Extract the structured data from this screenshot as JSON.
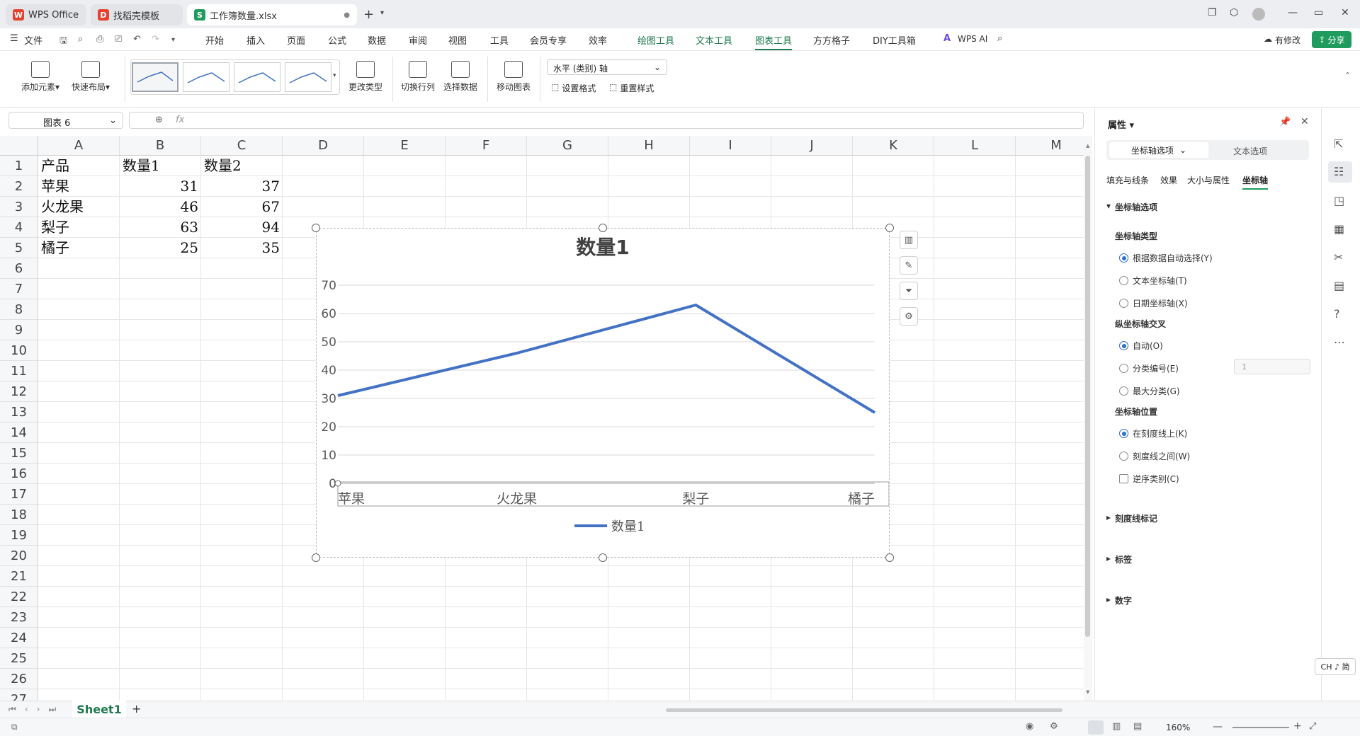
{
  "tabs": [
    {
      "label": "WPS Office"
    },
    {
      "label": "找稻壳模板"
    },
    {
      "label": "工作簿数量.xlsx"
    }
  ],
  "menu": {
    "file": "文件",
    "items": [
      "开始",
      "插入",
      "页面",
      "公式",
      "数据",
      "审阅",
      "视图",
      "工具",
      "会员专享",
      "效率",
      "绘图工具",
      "文本工具",
      "图表工具",
      "方方格子",
      "DIY工具箱"
    ],
    "wps_ai": "WPS AI",
    "modified": "有修改",
    "share": "分享"
  },
  "ribbon": {
    "add_element": "添加元素",
    "quick_layout": "快速布局",
    "change_type": "更改类型",
    "switch_rowcol": "切换行列",
    "select_data": "选择数据",
    "move_chart": "移动图表",
    "axis_select": "水平 (类别) 轴",
    "set_format": "设置格式",
    "reset_style": "重置样式"
  },
  "formula": {
    "namebox": "图表 6",
    "fx": "fx"
  },
  "columns": [
    "A",
    "B",
    "C",
    "D",
    "E",
    "F",
    "G",
    "H",
    "I",
    "J",
    "K",
    "L",
    "M"
  ],
  "rows": [
    "1",
    "2",
    "3",
    "4",
    "5",
    "6",
    "7",
    "8",
    "9",
    "10",
    "11",
    "12",
    "13",
    "14",
    "15",
    "16",
    "17",
    "18",
    "19",
    "20",
    "21",
    "22",
    "23",
    "24",
    "25",
    "26",
    "27"
  ],
  "table": {
    "headers": [
      "产品",
      "数量1",
      "数量2"
    ],
    "rows": [
      [
        "苹果",
        "31",
        "37"
      ],
      [
        "火龙果",
        "46",
        "67"
      ],
      [
        "梨子",
        "63",
        "94"
      ],
      [
        "橘子",
        "25",
        "35"
      ]
    ]
  },
  "chart_data": {
    "type": "line",
    "title": "数量1",
    "categories": [
      "苹果",
      "火龙果",
      "梨子",
      "橘子"
    ],
    "series": [
      {
        "name": "数量1",
        "values": [
          31,
          46,
          63,
          25
        ],
        "color": "#4472c4"
      }
    ],
    "ylim": [
      0,
      70
    ],
    "yticks": [
      "0",
      "10",
      "20",
      "30",
      "40",
      "50",
      "60",
      "70"
    ],
    "grid": true,
    "legend": "bottom"
  },
  "props": {
    "title": "属性",
    "tab_axis": "坐标轴选项",
    "tab_text": "文本选项",
    "subtabs": [
      "填充与线条",
      "效果",
      "大小与属性",
      "坐标轴"
    ],
    "section": "坐标轴选项",
    "axis_type": "坐标轴类型",
    "axis_type_opts": [
      "根据数据自动选择(Y)",
      "文本坐标轴(T)",
      "日期坐标轴(X)"
    ],
    "cross": "纵坐标轴交叉",
    "cross_opts": [
      "自动(O)",
      "分类编号(E)",
      "最大分类(G)"
    ],
    "cross_value": "1",
    "position": "坐标轴位置",
    "position_opts": [
      "在刻度线上(K)",
      "刻度线之间(W)"
    ],
    "reverse": "逆序类别(C)",
    "collapsed": [
      "刻度线标记",
      "标签",
      "数字"
    ]
  },
  "sheet_tab": "Sheet1",
  "status": {
    "zoom": "160%",
    "ime": "CH ♪ 简"
  }
}
